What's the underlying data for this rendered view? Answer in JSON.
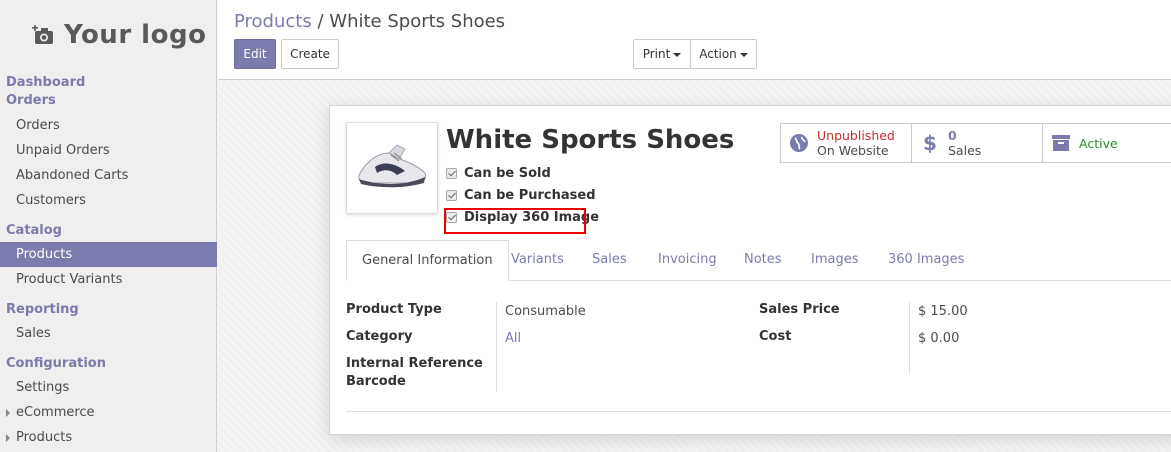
{
  "logo": {
    "text": "Your logo",
    "icon": "camera-plus-icon"
  },
  "sidebar": {
    "sections": [
      {
        "title": "Dashboard"
      },
      {
        "title": "Orders",
        "items": [
          "Orders",
          "Unpaid Orders",
          "Abandoned Carts",
          "Customers"
        ]
      },
      {
        "title": "Catalog",
        "items": [
          "Products",
          "Product Variants"
        ],
        "active": "Products"
      },
      {
        "title": "Reporting",
        "items": [
          "Sales"
        ]
      },
      {
        "title": "Configuration",
        "items": [
          "Settings"
        ],
        "tree_items": [
          "eCommerce",
          "Products"
        ]
      }
    ]
  },
  "breadcrumb": {
    "parent": "Products",
    "separator": "/",
    "current": "White Sports Shoes"
  },
  "toolbar": {
    "edit_label": "Edit",
    "create_label": "Create",
    "print_label": "Print",
    "action_label": "Action"
  },
  "product": {
    "name": "White Sports Shoes",
    "checkboxes": [
      {
        "label": "Can be Sold",
        "checked": true
      },
      {
        "label": "Can be Purchased",
        "checked": true
      },
      {
        "label": "Display 360 Image",
        "checked": true
      }
    ]
  },
  "stat_buttons": {
    "website": {
      "line1": "Unpublished",
      "line2": "On Website",
      "color": "#c9302c"
    },
    "sales": {
      "count": "0",
      "label": "Sales"
    },
    "active": {
      "label": "Active",
      "color": "#2e8b2e"
    }
  },
  "tabs": [
    "General Information",
    "Variants",
    "Sales",
    "Invoicing",
    "Notes",
    "Images",
    "360 Images"
  ],
  "fields": {
    "product_type": {
      "label": "Product Type",
      "value": "Consumable"
    },
    "category": {
      "label": "Category",
      "value": "All"
    },
    "internal_reference": {
      "label": "Internal Reference"
    },
    "barcode": {
      "label": "Barcode"
    },
    "sales_price": {
      "label": "Sales Price",
      "value": "$ 15.00"
    },
    "cost": {
      "label": "Cost",
      "value": "$ 0.00"
    }
  },
  "colors": {
    "brand": "#7c7bad"
  }
}
